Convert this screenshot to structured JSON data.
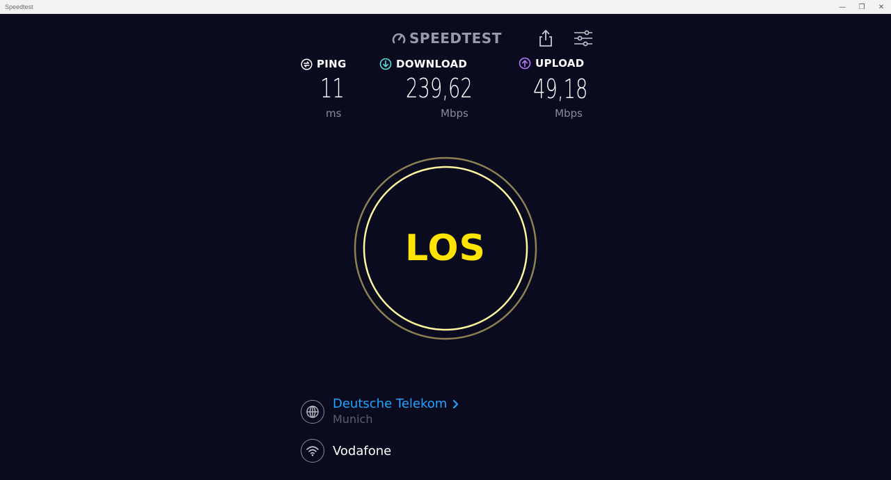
{
  "window": {
    "title": "Speedtest",
    "controls": {
      "minimize": "—",
      "restore": "❐",
      "close": "✕"
    }
  },
  "header": {
    "logo_text": "SPEEDTEST",
    "logo_icon": "speedometer-icon",
    "share_icon": "share-icon",
    "settings_icon": "sliders-icon"
  },
  "metrics": {
    "ping": {
      "label": "PING",
      "value": "11",
      "unit": "ms",
      "color": "#ffffff"
    },
    "download": {
      "label": "DOWNLOAD",
      "value": "239,62",
      "unit": "Mbps",
      "color": "#5ce0d8"
    },
    "upload": {
      "label": "UPLOAD",
      "value": "49,18",
      "unit": "Mbps",
      "color": "#b57cff"
    }
  },
  "go_button": {
    "label": "LOS",
    "color": "#ffe400"
  },
  "server": {
    "name": "Deutsche Telekom",
    "city": "Munich",
    "icon": "globe-icon"
  },
  "connection": {
    "isp": "Vodafone",
    "icon": "wifi-icon"
  }
}
